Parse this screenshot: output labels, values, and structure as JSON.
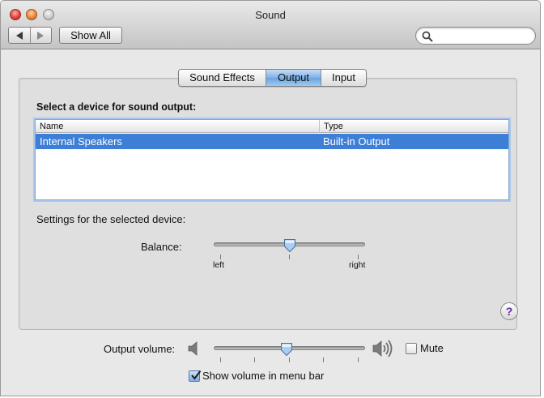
{
  "window": {
    "title": "Sound"
  },
  "toolbar": {
    "back_icon": "left-arrow-icon",
    "forward_icon": "right-arrow-icon",
    "show_all_label": "Show All",
    "search": {
      "value": "",
      "placeholder": ""
    }
  },
  "tabs": [
    {
      "label": "Sound Effects",
      "active": false
    },
    {
      "label": "Output",
      "active": true
    },
    {
      "label": "Input",
      "active": false
    }
  ],
  "output": {
    "heading": "Select a device for sound output:",
    "columns": [
      "Name",
      "Type"
    ],
    "rows": [
      {
        "name": "Internal Speakers",
        "type": "Built-in Output",
        "selected": true
      }
    ],
    "settings_label": "Settings for the selected device:",
    "balance": {
      "label": "Balance:",
      "left_label": "left",
      "right_label": "right",
      "value": 0.5
    }
  },
  "volume": {
    "label": "Output volume:",
    "value": 0.48,
    "mute_label": "Mute",
    "mute_checked": false,
    "show_in_menu_bar_label": "Show volume in menu bar",
    "show_in_menu_bar_checked": true
  },
  "help": {
    "label": "?"
  },
  "colors": {
    "selection": "#3d7fd6",
    "active_tab": "#7fb2e7",
    "help_glyph": "#5a2a9a"
  }
}
